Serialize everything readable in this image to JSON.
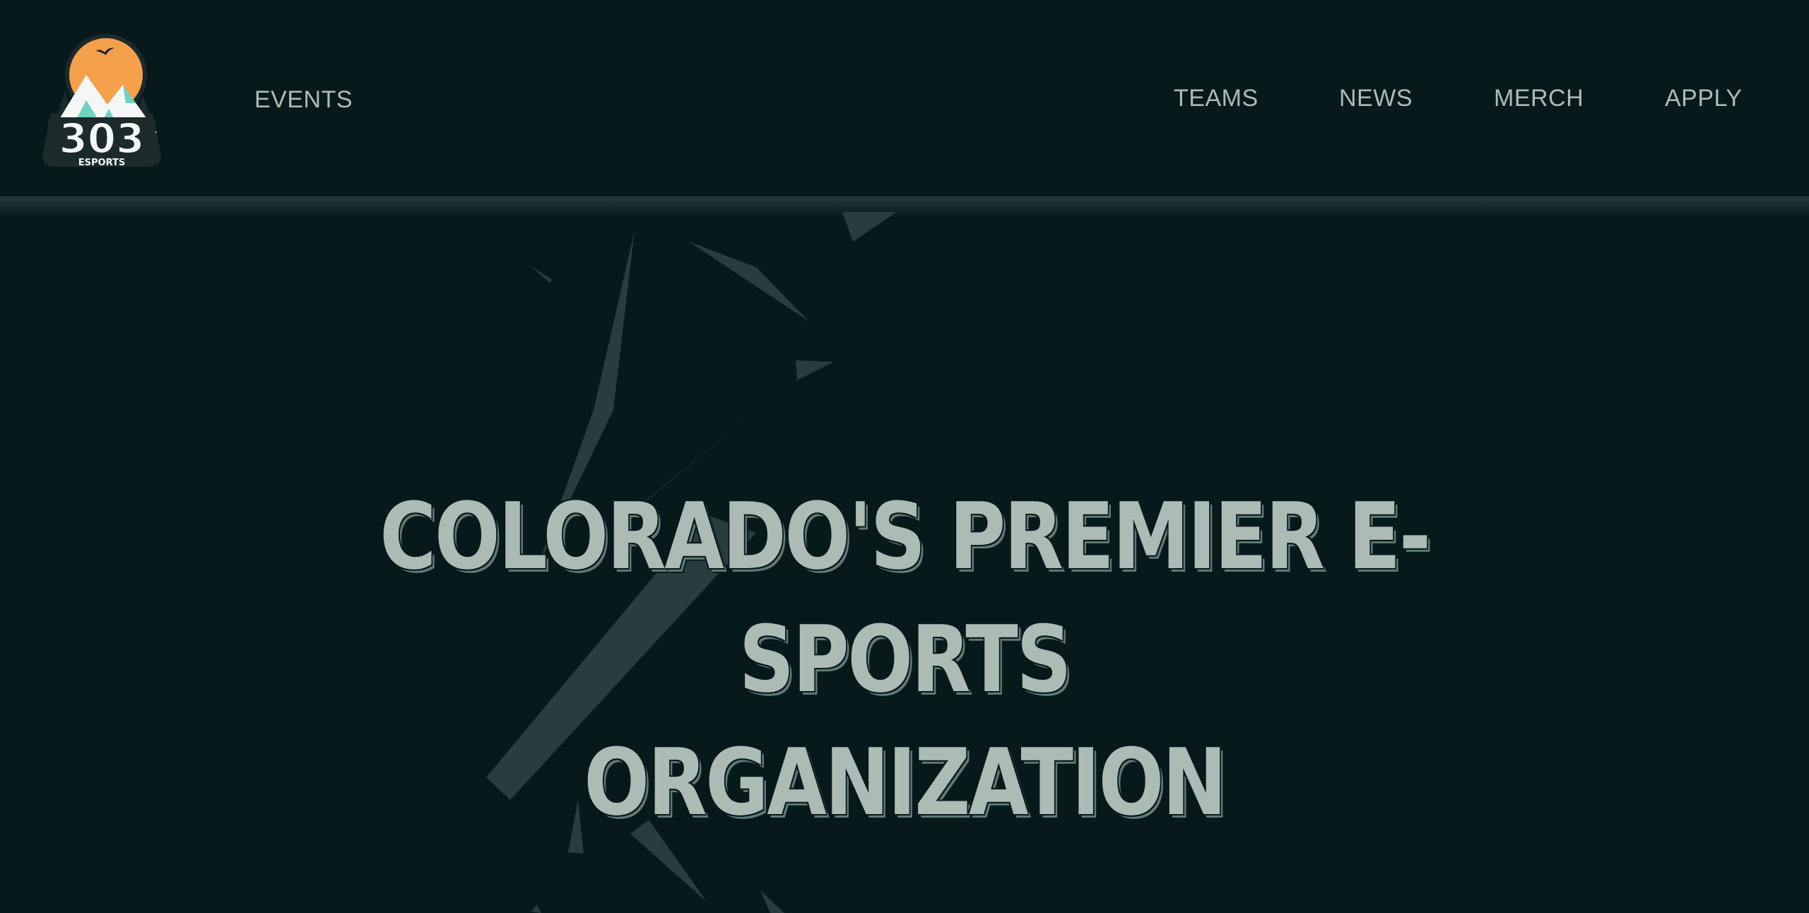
{
  "brand": {
    "logo_text": "303",
    "logo_subtext": "ESPORTS",
    "logo_icon": "mountain-sun-logo",
    "colors": {
      "background": "#08191c",
      "sun": "#f5a04a",
      "mountain": "#6fd3c0",
      "text": "#aebbb5"
    }
  },
  "nav": {
    "left_items": [
      {
        "label": "EVENTS"
      }
    ],
    "right_items": [
      {
        "label": "TEAMS"
      },
      {
        "label": "NEWS"
      },
      {
        "label": "MERCH"
      },
      {
        "label": "APPLY"
      }
    ]
  },
  "hero": {
    "title_line1": "COLORADO'S PREMIER E-SPORTS",
    "title_line2": "ORGANIZATION"
  }
}
